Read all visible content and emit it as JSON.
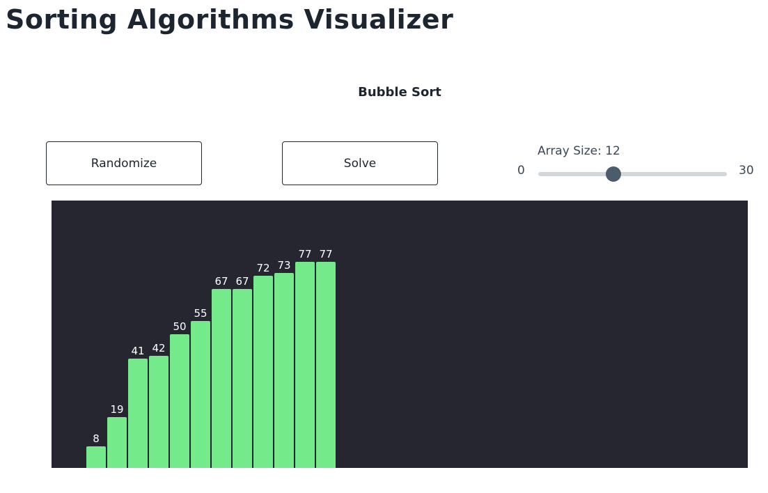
{
  "app": {
    "title": "Sorting Algorithms Visualizer"
  },
  "algorithm": {
    "name": "Bubble Sort"
  },
  "controls": {
    "randomize_label": "Randomize",
    "solve_label": "Solve",
    "slider": {
      "label": "Array Size: 12",
      "min": 0,
      "max": 30,
      "value": 12,
      "min_label": "0",
      "max_label": "30"
    }
  },
  "colors": {
    "bar": "#74ea8b",
    "canvas_background": "#252630",
    "slider_thumb": "#4d5c6b",
    "slider_track": "#d2d7dc"
  },
  "chart_data": {
    "type": "bar",
    "categories": [
      "",
      "",
      "",
      "",
      "",
      "",
      "",
      "",
      "",
      "",
      "",
      ""
    ],
    "values": [
      8,
      19,
      41,
      42,
      50,
      55,
      67,
      67,
      72,
      73,
      77,
      77
    ],
    "value_labels": [
      "8",
      "19",
      "41",
      "42",
      "50",
      "55",
      "67",
      "67",
      "72",
      "73",
      "77",
      "77"
    ],
    "title": "",
    "xlabel": "",
    "ylabel": "",
    "ylim": [
      0,
      100
    ]
  }
}
